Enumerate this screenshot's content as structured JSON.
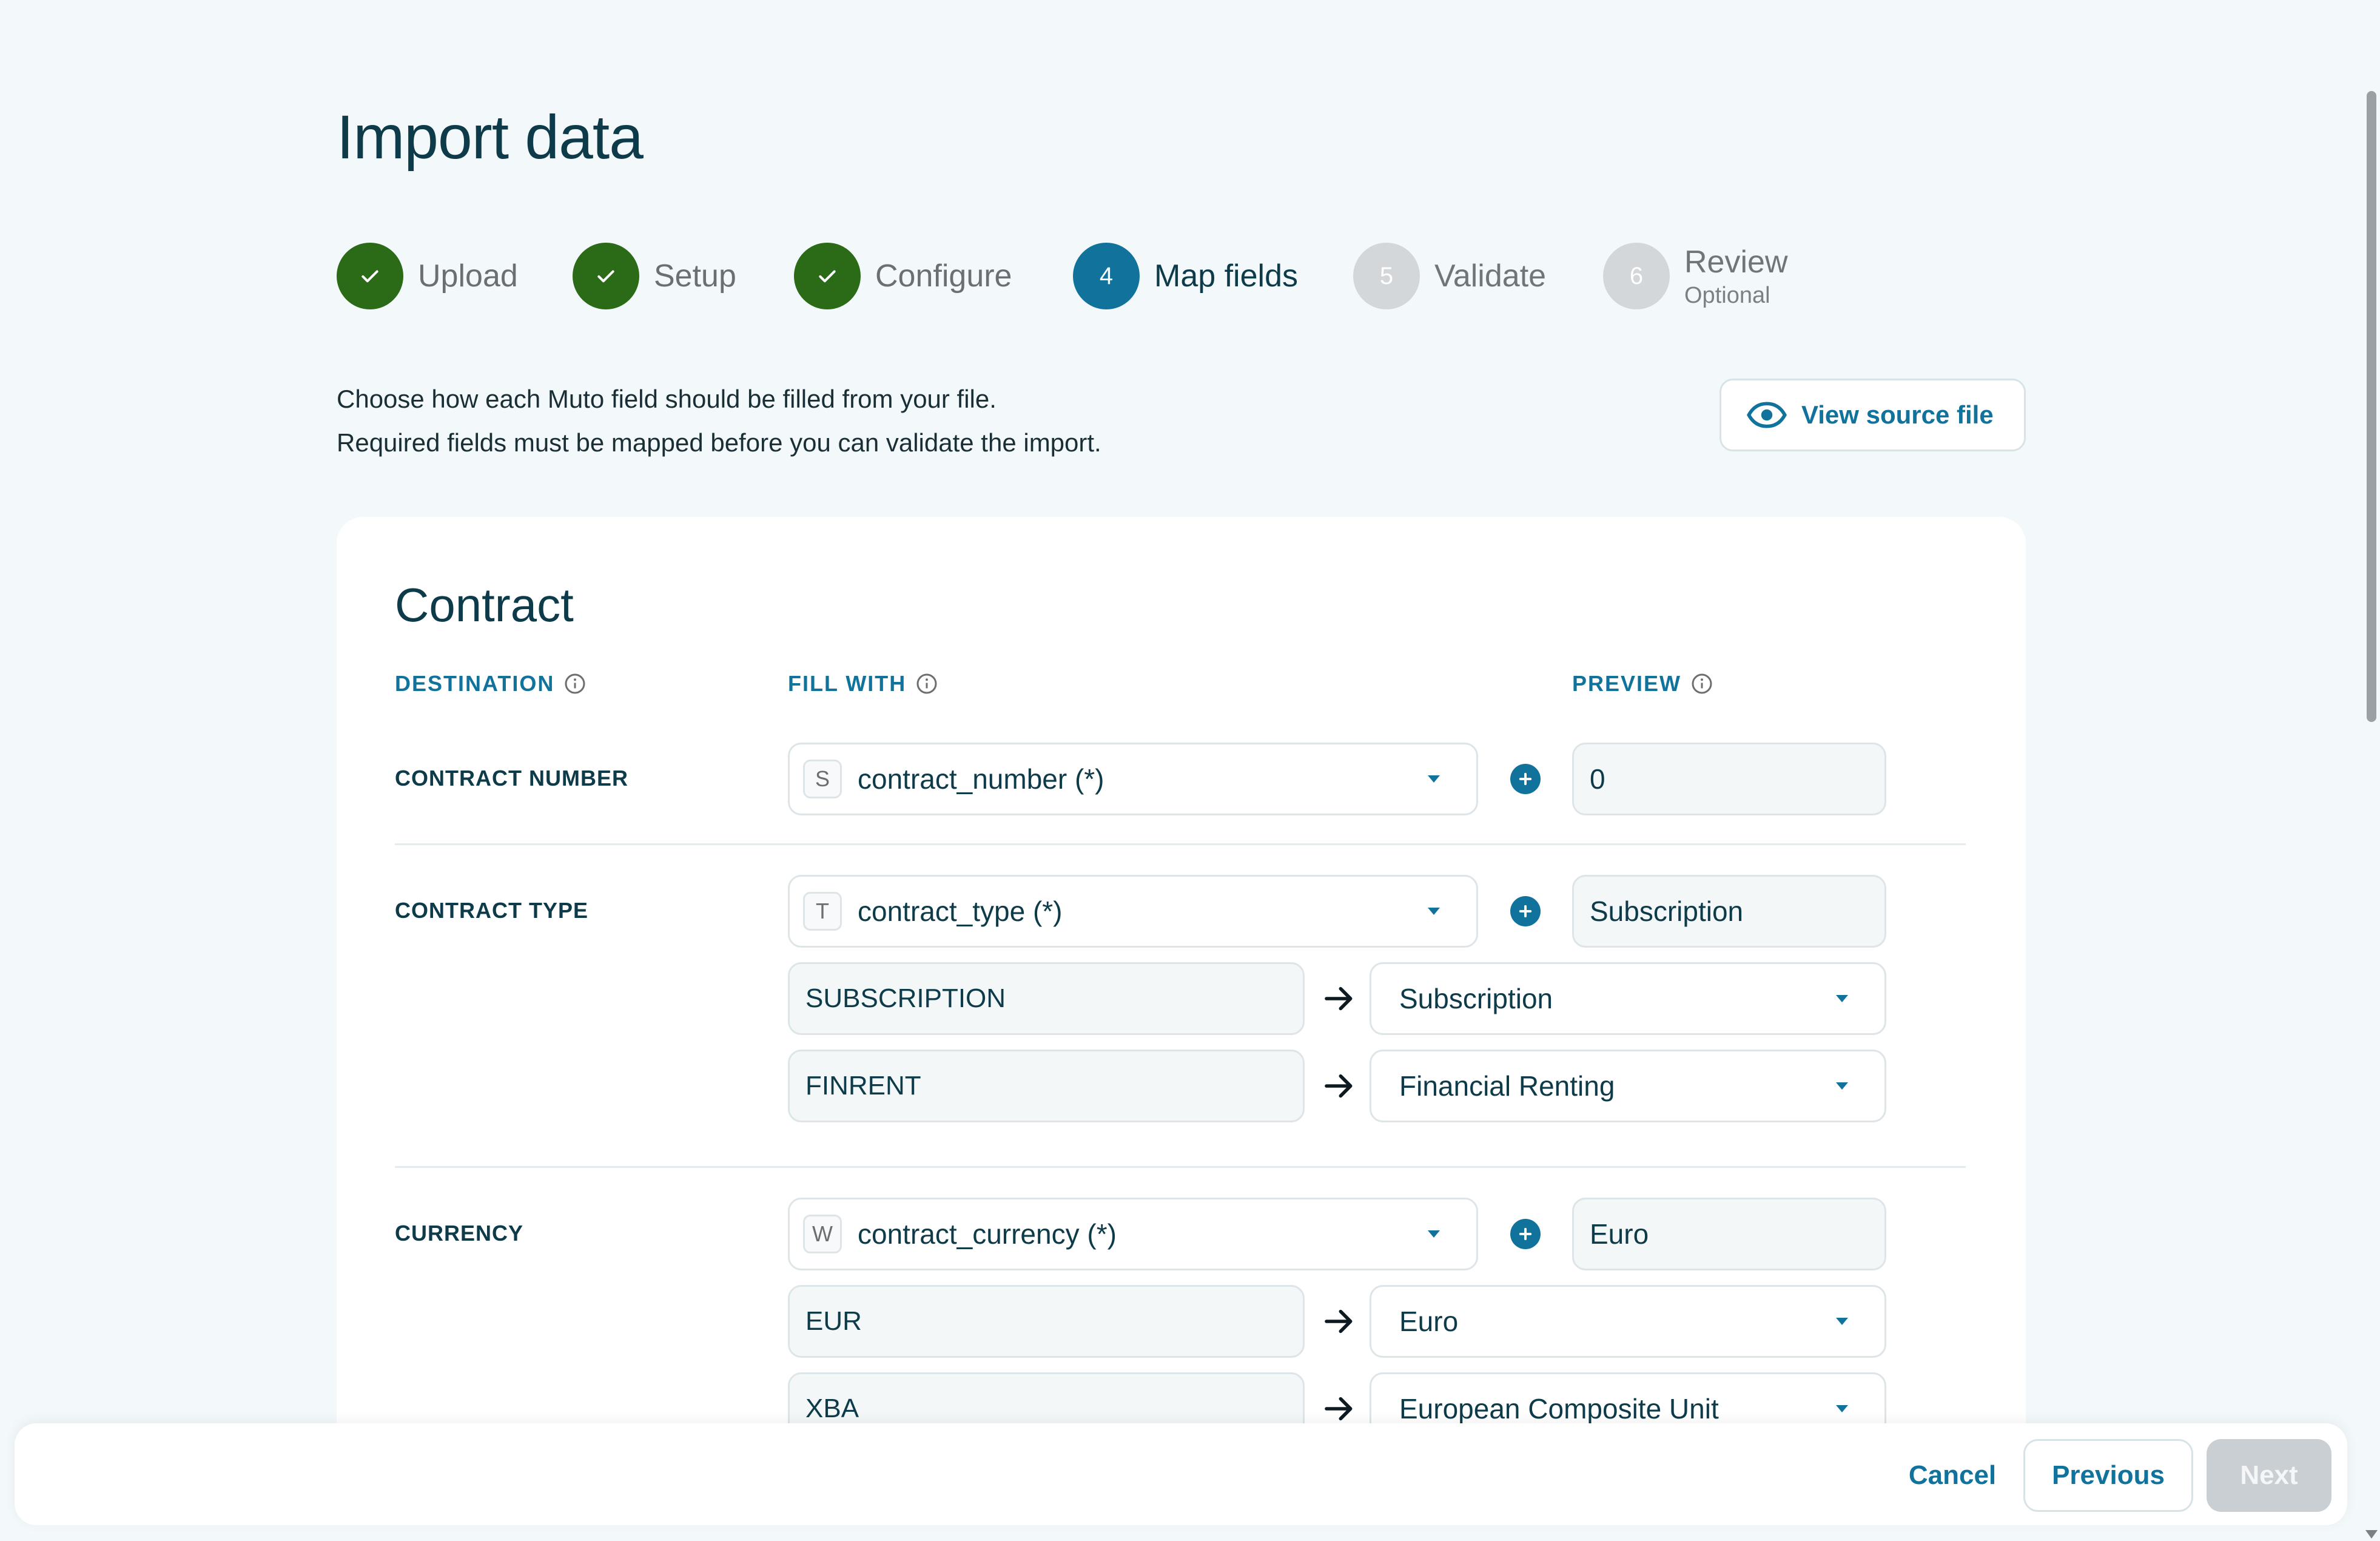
{
  "page": {
    "title": "Import data"
  },
  "steps": [
    {
      "number": "1",
      "label": "Upload",
      "state": "done"
    },
    {
      "number": "2",
      "label": "Setup",
      "state": "done"
    },
    {
      "number": "3",
      "label": "Configure",
      "state": "done"
    },
    {
      "number": "4",
      "label": "Map fields",
      "state": "active"
    },
    {
      "number": "5",
      "label": "Validate",
      "state": "todo"
    },
    {
      "number": "6",
      "label": "Review",
      "sublabel": "Optional",
      "state": "todo"
    }
  ],
  "description": {
    "line1": "Choose how each Muto field should be filled from your file.",
    "line2": "Required fields must be mapped before you can validate the import."
  },
  "view_source": {
    "label": "View source file",
    "icon": "eye-icon"
  },
  "card": {
    "title": "Contract",
    "columns": {
      "destination": "DESTINATION",
      "fill_with": "FILL WITH",
      "preview": "PREVIEW"
    },
    "rows": {
      "contract_number": {
        "label": "CONTRACT NUMBER",
        "type_tag": "S",
        "field": "contract_number (*)",
        "preview": "0"
      },
      "contract_type": {
        "label": "CONTRACT TYPE",
        "type_tag": "T",
        "field": "contract_type (*)",
        "preview": "Subscription",
        "mappings": [
          {
            "source": "SUBSCRIPTION",
            "target": "Subscription"
          },
          {
            "source": "FINRENT",
            "target": "Financial Renting"
          }
        ]
      },
      "currency": {
        "label": "CURRENCY",
        "type_tag": "W",
        "field": "contract_currency (*)",
        "preview": "Euro",
        "mappings": [
          {
            "source": "EUR",
            "target": "Euro"
          },
          {
            "source": "XBA",
            "target": "European Composite Unit"
          }
        ]
      }
    }
  },
  "footer": {
    "cancel": "Cancel",
    "previous": "Previous",
    "next": "Next"
  },
  "colors": {
    "accent": "#11739c",
    "done": "#2b6a16",
    "todo": "#d3d7d9",
    "background": "#f3f9fb"
  }
}
